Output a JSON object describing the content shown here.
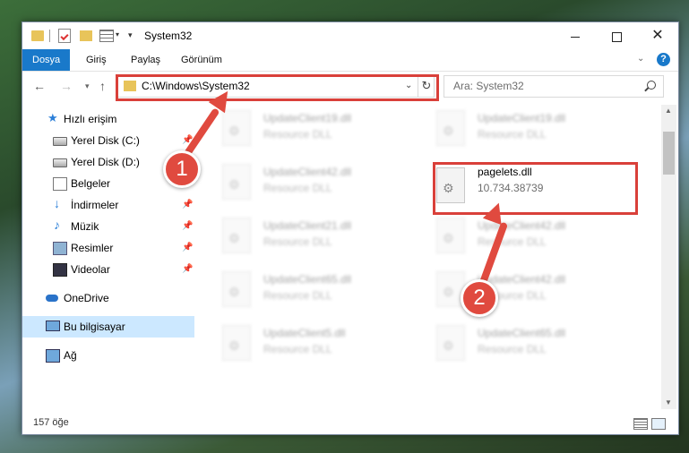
{
  "window": {
    "title": "System32",
    "controls": {
      "minimize": "",
      "maximize": "",
      "close": "✕"
    }
  },
  "ribbon": {
    "tabs": [
      {
        "label": "Dosya",
        "active": true
      },
      {
        "label": "Giriş"
      },
      {
        "label": "Paylaş"
      },
      {
        "label": "Görünüm"
      }
    ],
    "help": "?"
  },
  "nav": {
    "address": "C:\\Windows\\System32",
    "search_placeholder": "Ara: System32"
  },
  "sidebar": {
    "items": [
      {
        "label": "Hızlı erişim",
        "icon": "star-icon",
        "pinned": false
      },
      {
        "label": "Yerel Disk (C:)",
        "icon": "drive-icon",
        "pinned": true
      },
      {
        "label": "Yerel Disk (D:)",
        "icon": "drive-icon",
        "pinned": true
      },
      {
        "label": "Belgeler",
        "icon": "documents-icon",
        "pinned": true
      },
      {
        "label": "İndirmeler",
        "icon": "downloads-icon",
        "pinned": true
      },
      {
        "label": "Müzik",
        "icon": "music-icon",
        "pinned": true
      },
      {
        "label": "Resimler",
        "icon": "pictures-icon",
        "pinned": true
      },
      {
        "label": "Videolar",
        "icon": "videos-icon",
        "pinned": true
      },
      {
        "label": "OneDrive",
        "icon": "onedrive-icon",
        "pinned": false
      },
      {
        "label": "Bu bilgisayar",
        "icon": "computer-icon",
        "pinned": false,
        "selected": true
      },
      {
        "label": "Ağ",
        "icon": "network-icon",
        "pinned": false
      }
    ]
  },
  "files": {
    "left": [
      {
        "name": "UpdateClient19.dll",
        "desc": "Resource DLL"
      },
      {
        "name": "UpdateClient42.dll",
        "desc": "Resource DLL"
      },
      {
        "name": "UpdateClient21.dll",
        "desc": "Resource DLL"
      },
      {
        "name": "UpdateClient65.dll",
        "desc": "Resource DLL"
      },
      {
        "name": "UpdateClient5.dll",
        "desc": "Resource DLL"
      }
    ],
    "right": [
      {
        "name": "UpdateClient19.dll",
        "desc": "Resource DLL"
      },
      {
        "name": "pagelets.dll",
        "desc": "10.734.38739"
      },
      {
        "name": "UpdateClient42.dll",
        "desc": "Resource DLL"
      },
      {
        "name": "UpdateClient42.dll",
        "desc": "Resource DLL"
      },
      {
        "name": "UpdateClient65.dll",
        "desc": "Resource DLL"
      }
    ]
  },
  "status": {
    "count": "157 öğe"
  },
  "callouts": [
    "1",
    "2"
  ],
  "colors": {
    "accent": "#1979ca",
    "highlight": "#d9403a",
    "callout": "#e04a3f",
    "selected": "#cce8ff"
  }
}
